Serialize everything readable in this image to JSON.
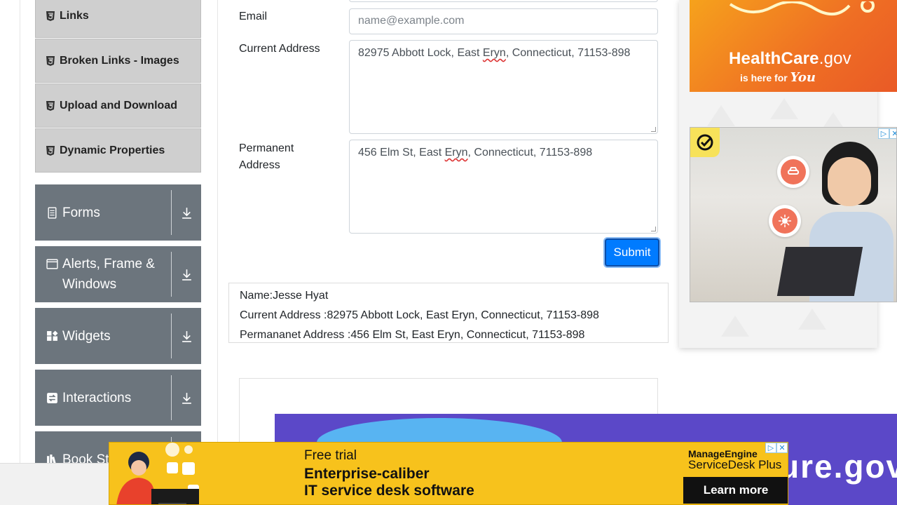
{
  "sidebar": {
    "sub_items": [
      {
        "label": "Links"
      },
      {
        "label": "Broken Links - Images"
      },
      {
        "label": "Upload and Download"
      },
      {
        "label": "Dynamic Properties"
      }
    ],
    "groups": [
      {
        "label": "Forms"
      },
      {
        "label": "Alerts, Frame & Windows"
      },
      {
        "label": "Widgets"
      },
      {
        "label": "Interactions"
      },
      {
        "label": "Book Store Application",
        "visible_label": "Book St"
      }
    ]
  },
  "form": {
    "email_label": "Email",
    "email_placeholder": "name@example.com",
    "current_address_label": "Current Address",
    "current_address_parts": [
      "82975 Abbott Lock, East ",
      "Eryn",
      ", Connecticut, 71153-898"
    ],
    "permanent_address_label": "Permanent Address",
    "permanent_address_parts": [
      "456 Elm St, East ",
      "Eryn",
      ", Connecticut, 71153-898"
    ],
    "submit_label": "Submit"
  },
  "output": {
    "name": "Name:Jesse Hyat",
    "current_address": "Current Address :82975 Abbott Lock, East Eryn, Connecticut, 71153-898",
    "permanent_address": "Permananet Address :456 Elm St, East Eryn, Connecticut, 71153-898"
  },
  "ads": {
    "healthcare": {
      "brand_bold": "HealthCare",
      "brand_suffix": ".gov",
      "tagline": "is here for",
      "tagline_script": "You"
    },
    "banner": {
      "line1": "Free trial",
      "line2": "Enterprise-caliber",
      "line3": "IT service desk software",
      "brand_top": "ManageEngine",
      "brand_product": "ServiceDesk Plus",
      "cta": "Learn more"
    },
    "purple_text": "ure.gov"
  },
  "colors": {
    "accent": "#007bff",
    "sidebar_group": "#6c757d",
    "sidebar_sub": "#cfcfcf",
    "banner": "#f7c21c",
    "purple_ad": "#5b48c8"
  }
}
